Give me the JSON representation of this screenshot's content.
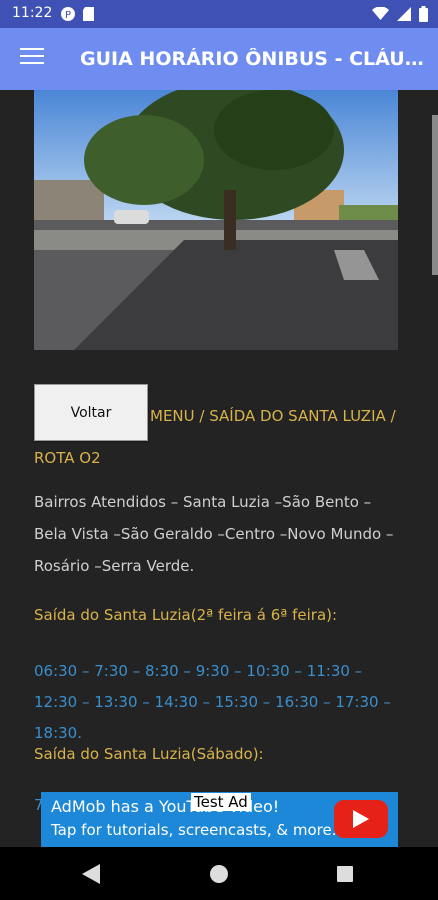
{
  "status_bar": {
    "time": "11:22",
    "icons": [
      "notification-app-icon",
      "sd-card-icon",
      "wifi-icon",
      "signal-icon",
      "battery-icon"
    ]
  },
  "app_bar": {
    "title": "GUIA HORÁRIO ÔNIBUS - CLÁUDIO",
    "menu_icon": "hamburger-menu-icon"
  },
  "page": {
    "voltar_label": "Voltar",
    "breadcrumb": {
      "menu": "MENU",
      "sep": "/",
      "saida": "SAÍDA DO SANTA LUZIA",
      "rota": "ROTA O2"
    },
    "bairros": "Bairros Atendidos – Santa Luzia –São Bento – Bela Vista –São Geraldo –Centro –Novo Mundo –Rosário –Serra Verde.",
    "weekday_heading": "Saída do Santa Luzia(2ª feira á 6ª feira):",
    "weekday_times": "06:30 – 7:30 – 8:30 – 9:30 – 10:30 – 11:30 – 12:30 – 13:30 – 14:30 – 15:30 – 16:30 – 17:30 – 18:30.",
    "saturday_heading": "Saída do Santa Luzia(Sábado):",
    "saturday_times_visible": "7"
  },
  "ad": {
    "line1": "AdMob has a YouTube video!",
    "line2": "Tap for tutorials, screencasts, & more.",
    "test_tag": "Test Ad"
  },
  "nav_bar": {
    "icons": [
      "back-icon",
      "home-icon",
      "recents-icon"
    ]
  }
}
